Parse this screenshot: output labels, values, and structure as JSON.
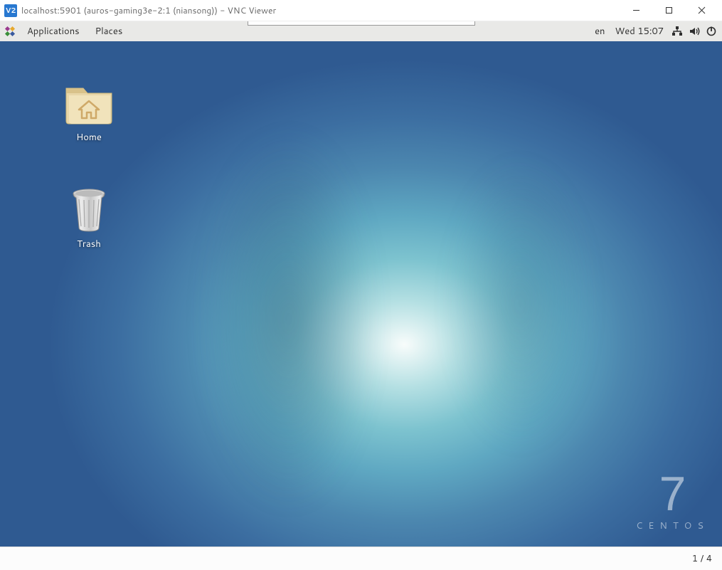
{
  "vnc": {
    "logo_text": "V2",
    "title": "localhost:5901 (auros-gaming3e-2:1 (niansong)) - VNC Viewer",
    "footer": "1 / 4"
  },
  "panel": {
    "applications": "Applications",
    "places": "Places",
    "lang": "en",
    "datetime": "Wed 15:07"
  },
  "desktop": {
    "icons": {
      "home": "Home",
      "trash": "Trash"
    },
    "brand": {
      "version": "7",
      "name": "CENTOS"
    }
  }
}
